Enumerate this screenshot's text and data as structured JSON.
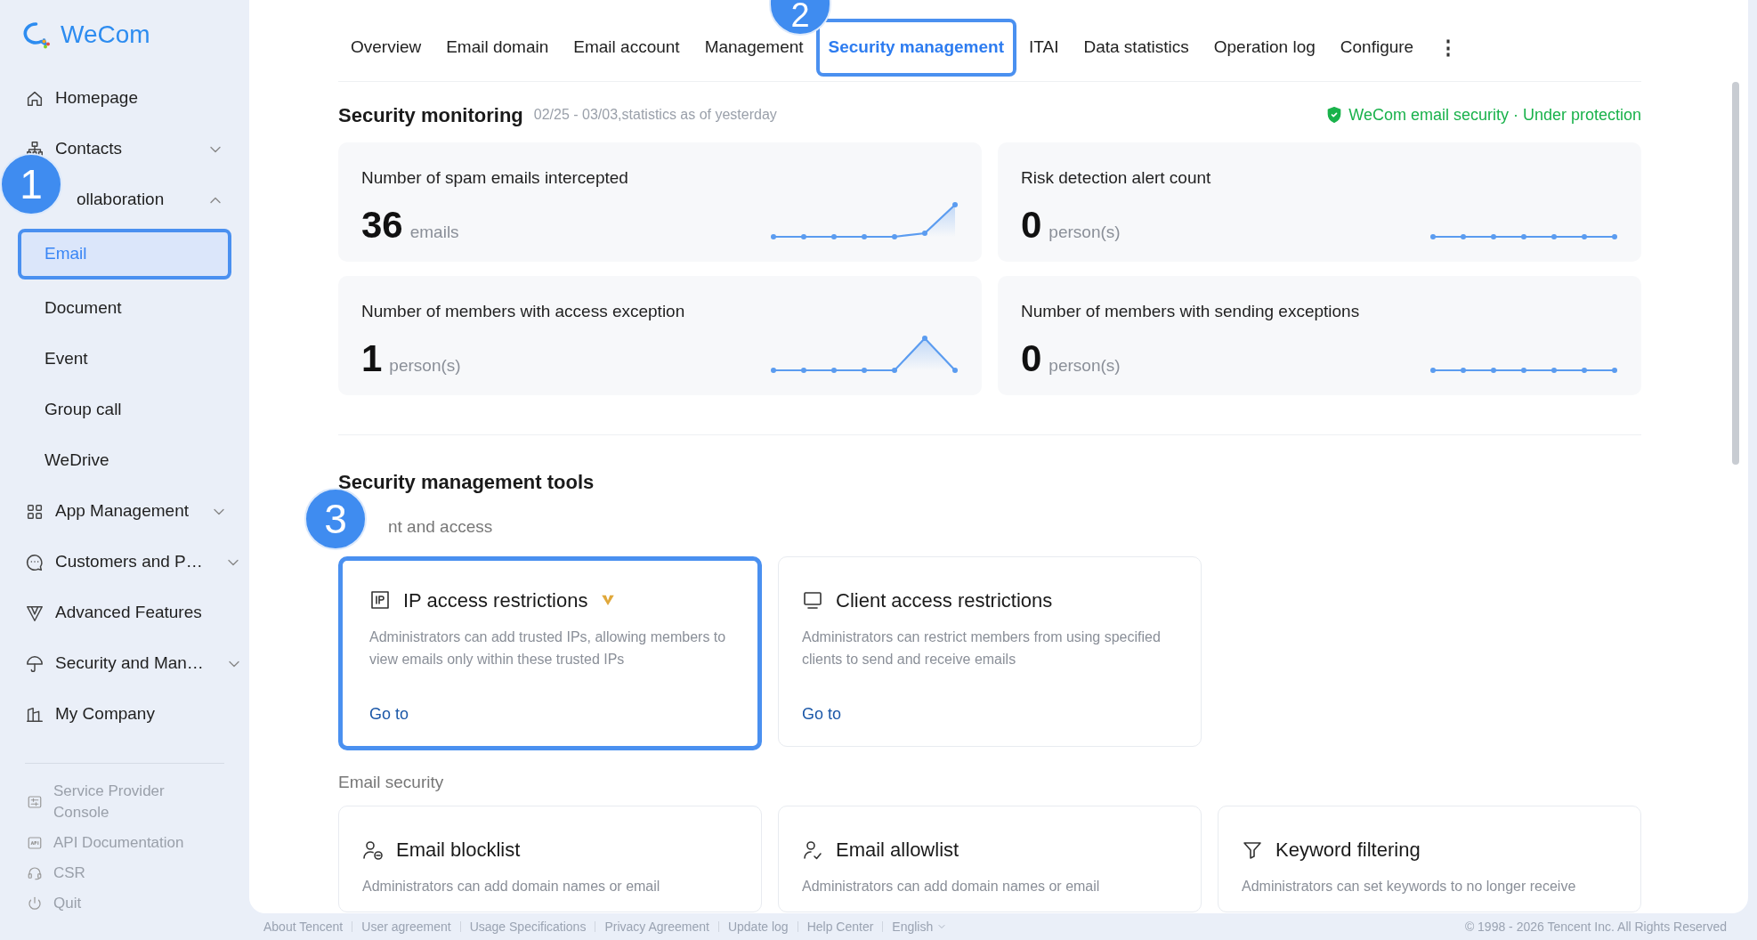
{
  "logo": {
    "text": "WeCom"
  },
  "sidebar": {
    "items": [
      {
        "label": "Homepage",
        "selected": false
      },
      {
        "label": "Contacts",
        "selected": false,
        "expanded": false
      },
      {
        "label": "ollaboration",
        "selected": false,
        "expanded": true,
        "children": [
          {
            "label": "Email",
            "selected": true,
            "highlighted": true
          },
          {
            "label": "Document",
            "selected": false,
            "highlighted": false
          },
          {
            "label": "Event",
            "selected": false,
            "highlighted": false
          },
          {
            "label": "Group call",
            "selected": false,
            "highlighted": false
          },
          {
            "label": "WeDrive",
            "selected": false,
            "highlighted": false
          }
        ]
      },
      {
        "label": "App Management",
        "selected": false,
        "expanded": false
      },
      {
        "label": "Customers and P…",
        "selected": false,
        "expanded": false
      },
      {
        "label": "Advanced Features",
        "selected": false
      },
      {
        "label": "Security and Man…",
        "selected": false,
        "expanded": false
      },
      {
        "label": "My Company",
        "selected": false
      }
    ],
    "bottom_links": [
      "Service Provider Console",
      "API Documentation",
      "CSR",
      "Quit"
    ]
  },
  "tabs": [
    {
      "label": "Overview",
      "selected": false,
      "highlighted": false
    },
    {
      "label": "Email domain",
      "selected": false,
      "highlighted": false
    },
    {
      "label": "Email account",
      "selected": false,
      "highlighted": false
    },
    {
      "label": "Management",
      "selected": false,
      "highlighted": false
    },
    {
      "label": "Security management",
      "selected": true,
      "highlighted": true
    },
    {
      "label": "ITAI",
      "selected": false,
      "highlighted": false
    },
    {
      "label": "Data statistics",
      "selected": false,
      "highlighted": false
    },
    {
      "label": "Operation log",
      "selected": false,
      "highlighted": false
    },
    {
      "label": "Configure",
      "selected": false,
      "highlighted": false
    }
  ],
  "more_menu": "⋮",
  "monitoring": {
    "title": "Security monitoring",
    "period": "02/25 - 03/03,statistics as of yesterday",
    "status": "WeCom email security · Under protection",
    "stats": [
      {
        "title": "Number of spam emails intercepted",
        "value": "36",
        "unit": "emails"
      },
      {
        "title": "Risk detection alert count",
        "value": "0",
        "unit": "person(s)"
      },
      {
        "title": "Number of members with access exception",
        "value": "1",
        "unit": "person(s)"
      },
      {
        "title": "Number of members with sending exceptions",
        "value": "0",
        "unit": "person(s)"
      }
    ]
  },
  "tools": {
    "title": "Security management tools",
    "sections": [
      {
        "title": "nt and access",
        "cards": [
          {
            "title": "IP access restrictions",
            "premium": true,
            "highlighted": true,
            "description": "Administrators can add trusted IPs, allowing members to view emails only within these trusted IPs",
            "link": "Go to"
          },
          {
            "title": "Client access restrictions",
            "premium": false,
            "highlighted": false,
            "description": "Administrators can restrict members from using specified clients to send and receive emails",
            "link": "Go to"
          }
        ]
      },
      {
        "title": "Email security",
        "cards": [
          {
            "title": "Email blocklist",
            "premium": false,
            "highlighted": false,
            "description": "Administrators can add domain names or email"
          },
          {
            "title": "Email allowlist",
            "premium": false,
            "highlighted": false,
            "description": "Administrators can add domain names or email"
          },
          {
            "title": "Keyword filtering",
            "premium": false,
            "highlighted": false,
            "description": "Administrators can set keywords to no longer receive"
          }
        ]
      }
    ]
  },
  "footer": {
    "links": [
      "About Tencent",
      "User agreement",
      "Usage Specifications",
      "Privacy Agreement",
      "Update log",
      "Help Center"
    ],
    "language": "English",
    "copyright": "© 1998 - 2026 Tencent Inc. All Rights Reserved"
  },
  "annotations": [
    {
      "number": "1"
    },
    {
      "number": "2"
    },
    {
      "number": "3"
    }
  ]
}
